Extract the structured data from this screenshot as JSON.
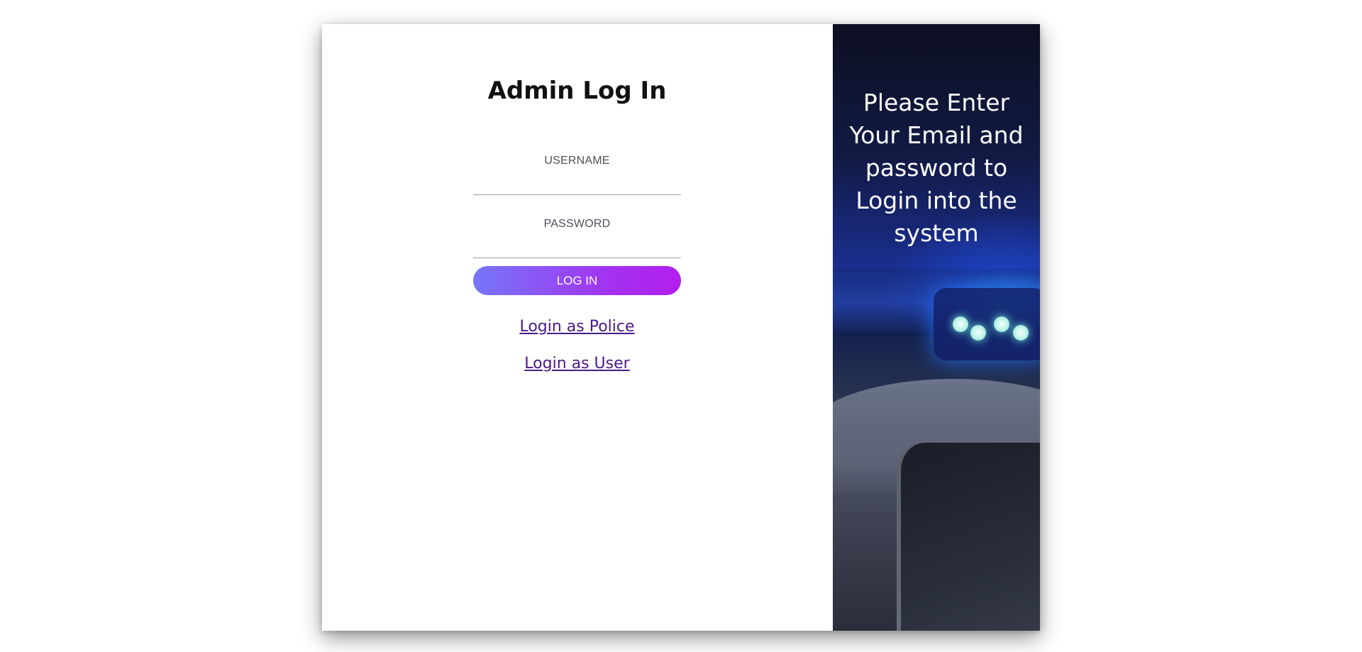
{
  "login_form": {
    "title": "Admin Log In",
    "username_label": "USERNAME",
    "username_value": "",
    "password_label": "PASSWORD",
    "password_value": "",
    "submit_label": "LOG IN",
    "alt_links": [
      {
        "label": "Login as Police"
      },
      {
        "label": "Login as User"
      }
    ]
  },
  "side_panel": {
    "message": "Please Enter Your Email and password to Login into the system",
    "background_image": "police-car-siren-photo"
  },
  "colors": {
    "button_gradient_start": "#7676f8",
    "button_gradient_end": "#b11ff0",
    "link": "#4a1a86",
    "panel_text": "#ffffff"
  }
}
